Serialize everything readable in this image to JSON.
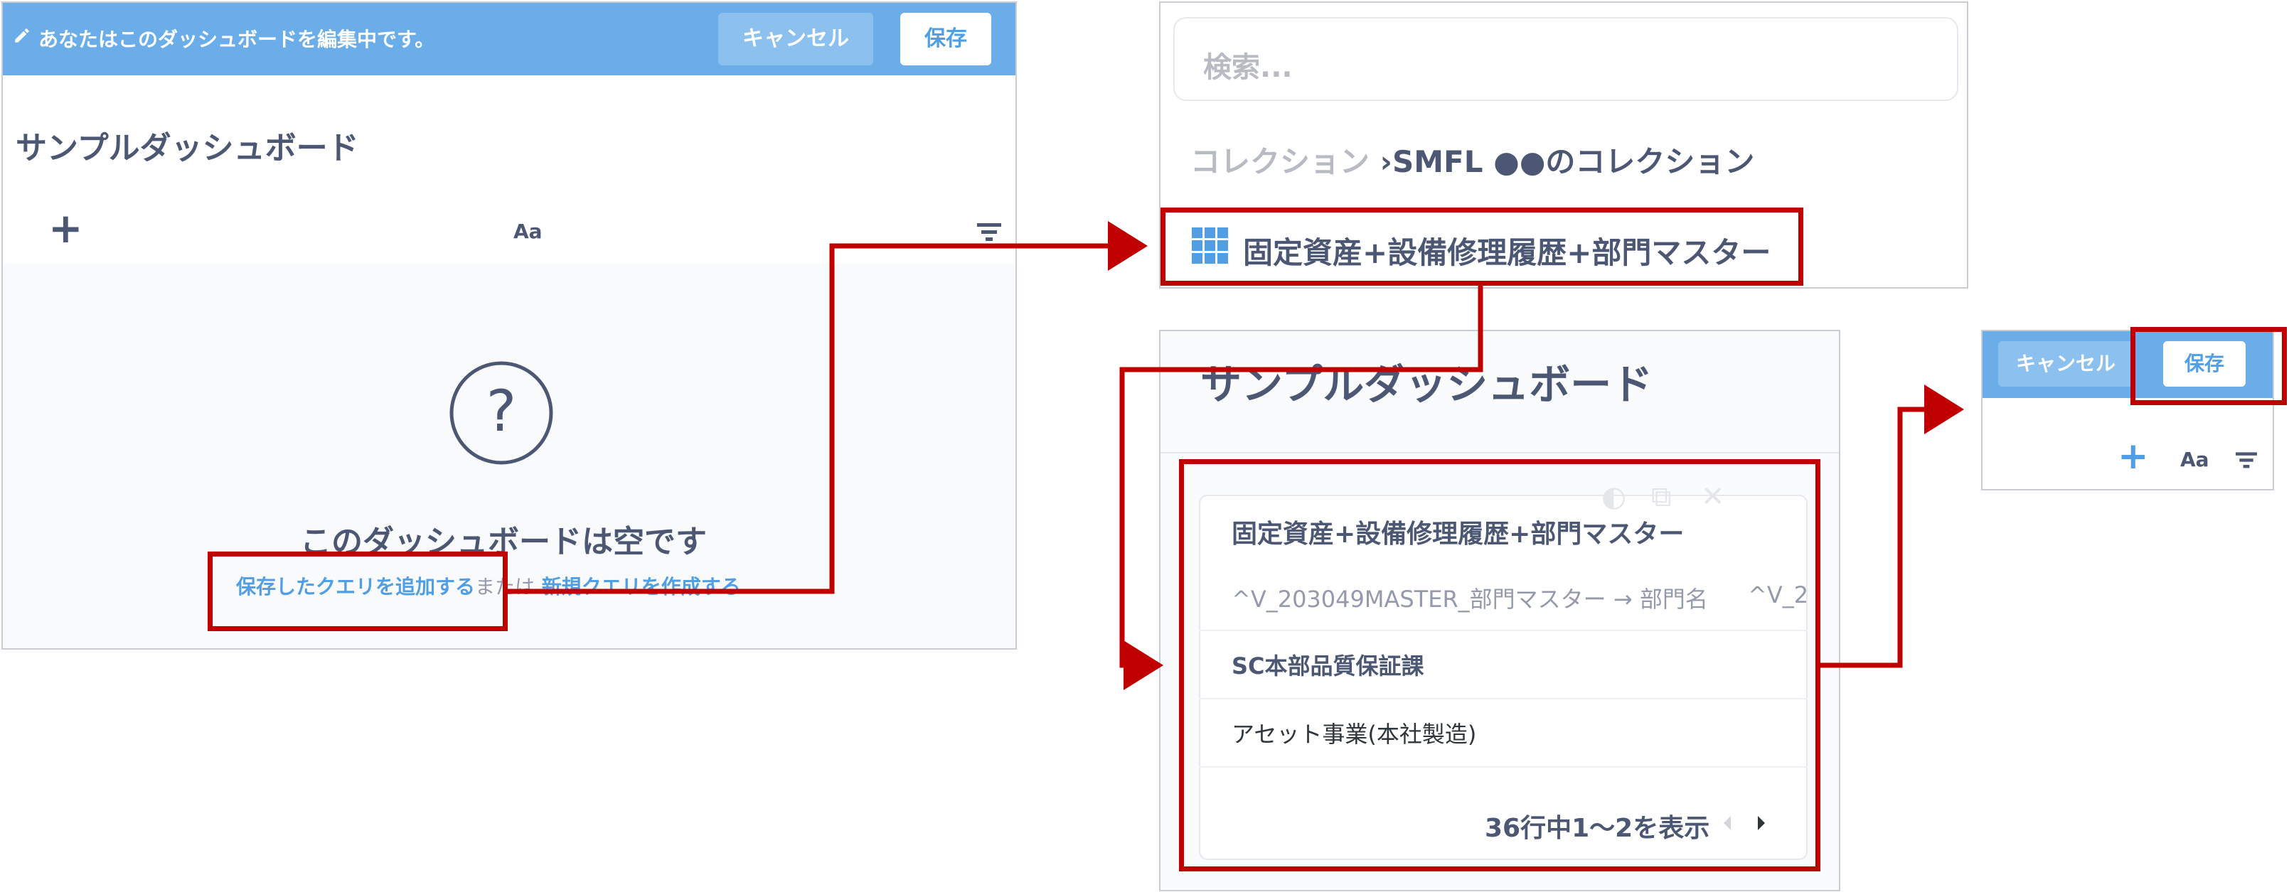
{
  "panel_edit": {
    "edit_notice": "あなたはこのダッシュボードを編集中です。",
    "cancel_label": "キャンセル",
    "save_label": "保存",
    "dashboard_title": "サンプルダッシュボード",
    "add_icon": "plus-icon",
    "text_label": "Aa",
    "filter_icon": "filter-icon",
    "empty_icon": "question-circle-icon",
    "empty_title": "このダッシュボードは空です",
    "add_saved_query_link": "保存したクエリを追加する",
    "or_text": "または",
    "new_query_link": "新規クエリを作成する"
  },
  "panel_search": {
    "search_placeholder": "検索...",
    "breadcrumb_root": "コレクション",
    "breadcrumb_sep": "›",
    "breadcrumb_1": "SMFL",
    "breadcrumb_2": "●●のコレクション",
    "result_icon": "grid-icon",
    "result_label": "固定資産+設備修理履歴+部門マスター"
  },
  "panel_card": {
    "dashboard_title": "サンプルダッシュボード",
    "card_title": "固定資産+設備修理履歴+部門マスター",
    "column_1": "^V_203049MASTER_部門マスター → 部門名",
    "column_2": "^V_2",
    "rows": [
      "SC本部品質保証課",
      "アセット事業(本社製造)"
    ],
    "paging_text": "36行中1〜2を表示",
    "prev_icon": "caret-left-icon",
    "next_icon": "caret-right-icon"
  },
  "panel_toolbar": {
    "cancel_label": "キャンセル",
    "save_label": "保存",
    "text_label": "Aa"
  },
  "colors": {
    "highlight": "#c00000",
    "header_bar": "#6aade8",
    "brand_blue": "#509ee3",
    "text_dark": "#4c5773"
  }
}
